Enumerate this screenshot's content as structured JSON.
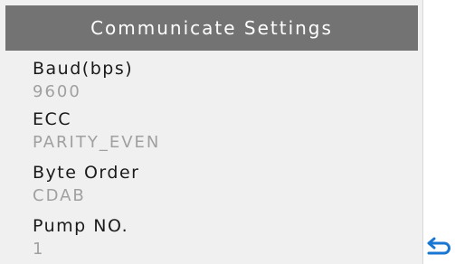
{
  "header": {
    "title": "Communicate Settings"
  },
  "settings": [
    {
      "label": "Baud(bps)",
      "value": "9600"
    },
    {
      "label": "ECC",
      "value": "PARITY_EVEN"
    },
    {
      "label": "Byte Order",
      "value": "CDAB"
    },
    {
      "label": "Pump NO.",
      "value": "1"
    }
  ],
  "back_icon": "return-arrow-icon",
  "colors": {
    "header_bg": "#737373",
    "panel_bg": "#f0f0f0",
    "label": "#1a1a1a",
    "value": "#a0a0a0",
    "back_icon": "#1976d2"
  }
}
